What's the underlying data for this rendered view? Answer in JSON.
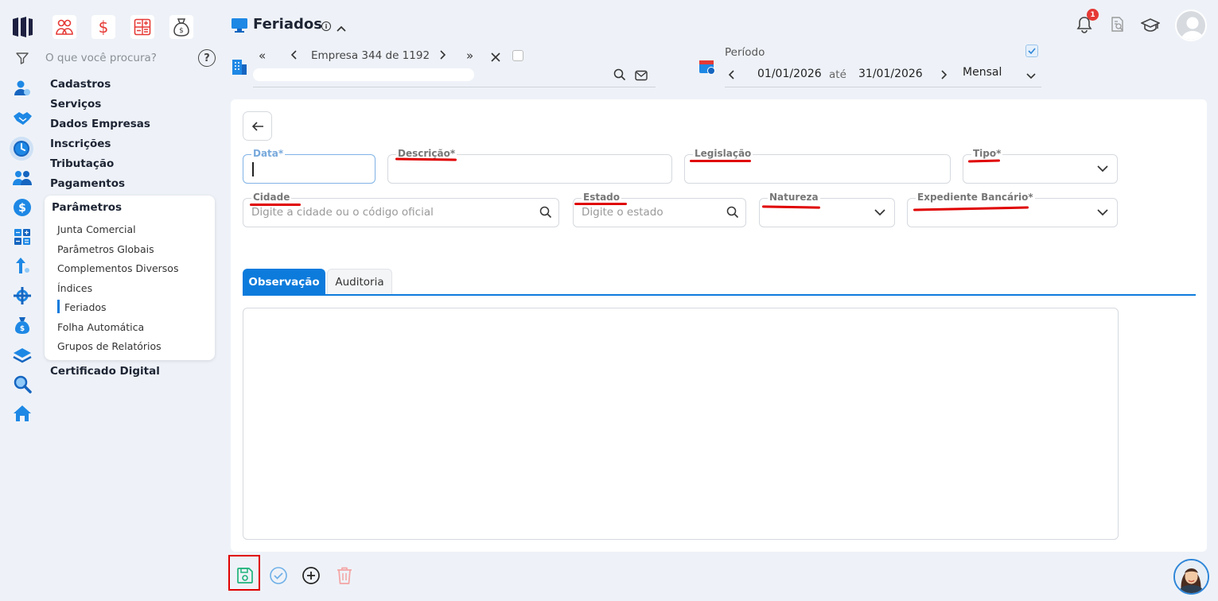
{
  "app": {
    "title": "Feriados"
  },
  "sidebar": {
    "search_placeholder": "O que você procura?",
    "menu": [
      "Cadastros",
      "Serviços",
      "Dados Empresas",
      "Inscrições",
      "Tributação",
      "Pagamentos"
    ],
    "submenu_title": "Parâmetros",
    "submenu_items": [
      "Junta Comercial",
      "Parâmetros Globais",
      "Complementos Diversos",
      "Índices",
      "Feriados",
      "Folha Automática",
      "Grupos de Relatórios"
    ],
    "active_item": "Feriados",
    "bottom_item": "Certificado Digital"
  },
  "company_nav": {
    "label": "Empresa",
    "current": "344",
    "sep": "de",
    "total": "1192"
  },
  "period": {
    "label": "Período",
    "start": "01/01/2026",
    "until": "até",
    "end": "31/01/2026",
    "mode": "Mensal"
  },
  "notifications": {
    "count": "1"
  },
  "form": {
    "data_label": "Data*",
    "descricao_label": "Descrição*",
    "legislacao_label": "Legislação",
    "tipo_label": "Tipo*",
    "cidade_label": "Cidade",
    "cidade_placeholder": "Digite a cidade ou o código oficial",
    "estado_label": "Estado",
    "estado_placeholder": "Digite o estado",
    "natureza_label": "Natureza",
    "expediente_label": "Expediente Bancário*"
  },
  "tabs": [
    {
      "label": "Observação",
      "active": true
    },
    {
      "label": "Auditoria",
      "active": false
    }
  ],
  "colors": {
    "accent": "#0d7bdc",
    "highlight": "#e00000",
    "save": "#1fb37a"
  }
}
